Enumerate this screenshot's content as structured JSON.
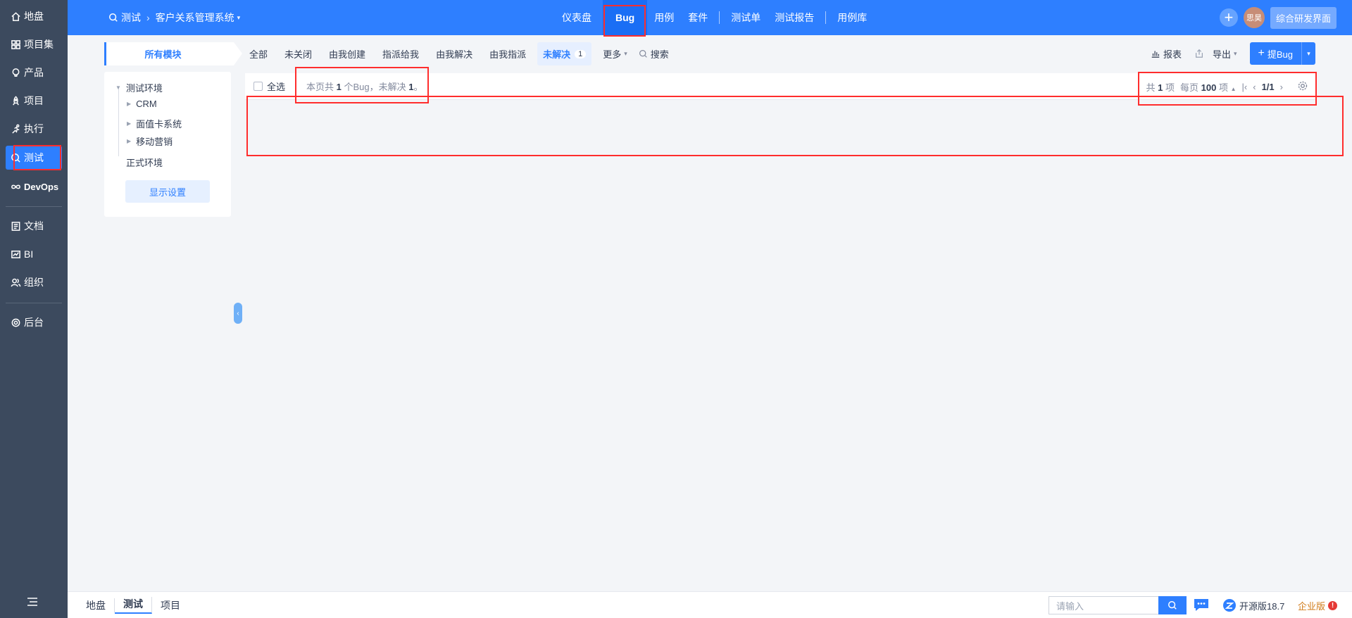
{
  "sidebar": {
    "items": [
      {
        "label": "地盘",
        "icon": "home-icon"
      },
      {
        "label": "项目集",
        "icon": "grid-icon"
      },
      {
        "label": "产品",
        "icon": "lightbulb-icon"
      },
      {
        "label": "项目",
        "icon": "rocket-icon"
      },
      {
        "label": "执行",
        "icon": "run-icon"
      },
      {
        "label": "测试",
        "icon": "search-icon",
        "active": true
      },
      {
        "label": "DevOps",
        "icon": "infinity-icon"
      },
      {
        "label": "文档",
        "icon": "document-icon"
      },
      {
        "label": "BI",
        "icon": "chart-icon"
      },
      {
        "label": "组织",
        "icon": "people-icon"
      },
      {
        "label": "后台",
        "icon": "gear-icon"
      }
    ]
  },
  "header": {
    "breadcrumb_app": "测试",
    "breadcrumb_product": "客户关系管理系统",
    "nav": [
      "仪表盘",
      "Bug",
      "用例",
      "套件",
      "测试单",
      "测试报告",
      "用例库"
    ],
    "active_nav": "Bug",
    "avatar_text": "思昊",
    "switch_button": "综合研发界面"
  },
  "module_panel": {
    "tab_label": "所有模块",
    "tree": [
      "测试环境",
      "CRM",
      "面值卡系统",
      "移动营销",
      "正式环境"
    ],
    "settings_button": "显示设置"
  },
  "filters": {
    "tabs": [
      "全部",
      "未关闭",
      "由我创建",
      "指派给我",
      "由我解决",
      "由我指派"
    ],
    "active_tab": "未解决",
    "active_count": "1",
    "more": "更多",
    "search": "搜索"
  },
  "toolbar": {
    "report": "报表",
    "export": "导出",
    "create_bug": "提Bug"
  },
  "table": {
    "select_all": "全选",
    "summary_prefix": "本页共",
    "summary_count": "1",
    "summary_mid": "个Bug，未解决",
    "summary_unresolved": "1",
    "summary_end": "。",
    "total_prefix": "共",
    "total": "1",
    "total_suffix": "项",
    "per_page_prefix": "每页",
    "per_page": "100",
    "per_page_suffix": "项",
    "page": "1/1"
  },
  "bottombar": {
    "crumbs": [
      "地盘",
      "测试",
      "项目"
    ],
    "search_placeholder": "请输入",
    "version": "开源版18.7",
    "enterprise": "企业版"
  },
  "colors": {
    "primary": "#2e7fff",
    "sidebar": "#3c4a5e",
    "highlight_box": "#ff2d2d"
  }
}
